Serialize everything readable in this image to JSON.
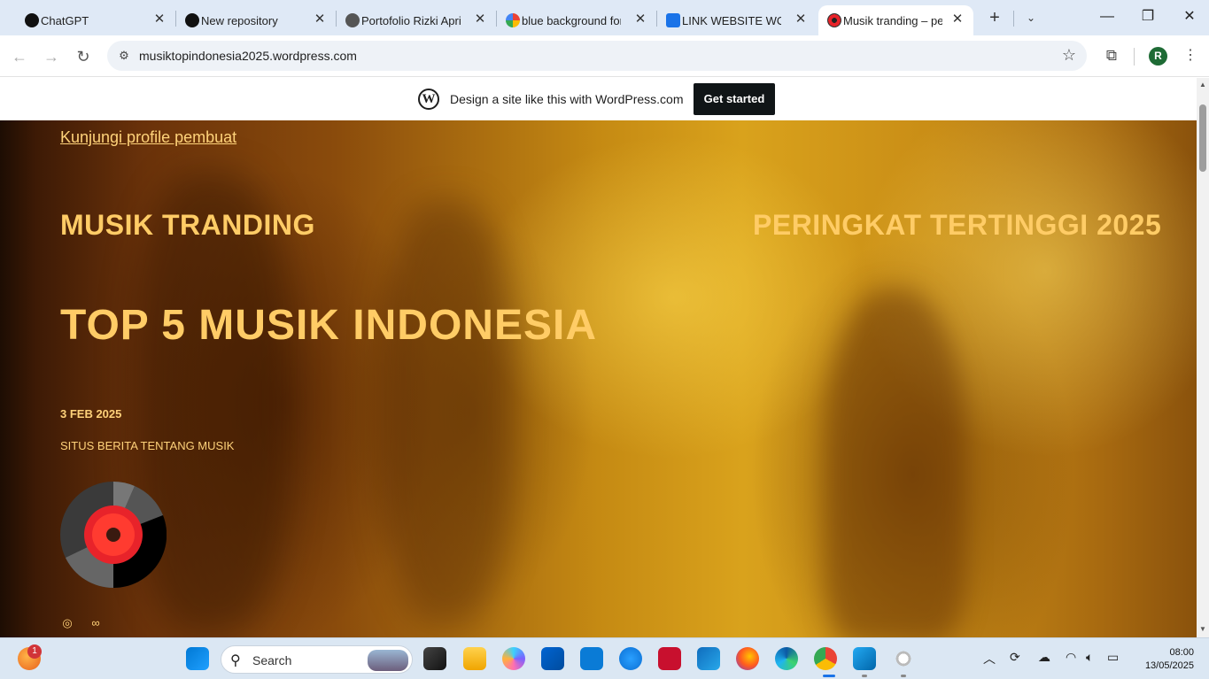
{
  "tabs": [
    {
      "title": "ChatGPT",
      "icon": "chatgpt-icon",
      "color": "#111111"
    },
    {
      "title": "New repository",
      "icon": "github-icon",
      "color": "#111111"
    },
    {
      "title": "Portofolio Rizki Apriz",
      "icon": "globe-icon",
      "color": "#555555"
    },
    {
      "title": "blue background for",
      "icon": "google-icon",
      "color": "#4285f4"
    },
    {
      "title": "LINK WEBSITE WORD",
      "icon": "classroom-icon",
      "color": "#1a73e8"
    },
    {
      "title": "Musik tranding – pe",
      "icon": "disc-favicon",
      "color": "#e8232a"
    }
  ],
  "toolbar": {
    "url": "musiktopindonesia2025.wordpress.com",
    "avatar_letter": "R"
  },
  "wp_banner": {
    "text": "Design a site like this with WordPress.com",
    "button": "Get started"
  },
  "hero": {
    "profile_link": "Kunjungi profile pembuat",
    "left_heading": "MUSIK TRANDING",
    "right_heading": "PERINGKAT TERTINGGI 2025",
    "main_heading": "TOP 5 MUSIK INDONESIA",
    "date": "3 FEB 2025",
    "tagline": "SITUS BERITA TENTANG MUSIK"
  },
  "taskbar": {
    "search_label": "Search",
    "notification_count": "1",
    "time": "08:00",
    "date": "13/05/2025"
  }
}
